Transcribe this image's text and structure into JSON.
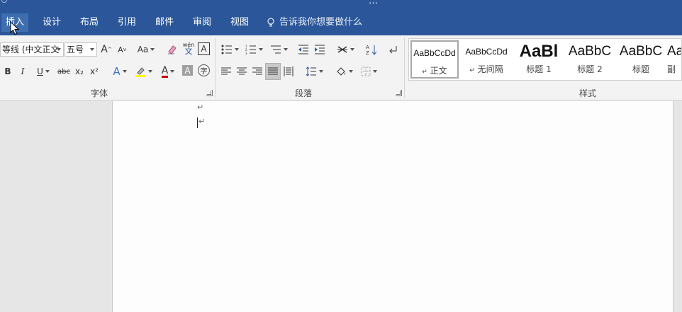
{
  "title_bar": {
    "title_fragment": "…"
  },
  "tabs": [
    {
      "label": "插入"
    },
    {
      "label": "设计"
    },
    {
      "label": "布局"
    },
    {
      "label": "引用"
    },
    {
      "label": "邮件"
    },
    {
      "label": "审阅"
    },
    {
      "label": "视图"
    }
  ],
  "tell_me": {
    "placeholder": "告诉我你想要做什么"
  },
  "font_group": {
    "label": "字体",
    "font_name": "等线 (中文正文",
    "font_size": "五号",
    "grow_font": "A",
    "shrink_font": "A",
    "change_case": "Aa",
    "phonetic_guide": "wén",
    "phonetic_char": "文",
    "char_border": "A",
    "bold": "B",
    "italic": "I",
    "underline": "U",
    "strikethrough": "abc",
    "subscript": "x₂",
    "superscript": "x²",
    "text_effects": "A",
    "font_color": "A",
    "char_shading": "A",
    "enclose_char": "字"
  },
  "paragraph_group": {
    "label": "段落"
  },
  "styles_group": {
    "label": "样式",
    "items": [
      {
        "sample": "AaBbCcDd",
        "name": "正文",
        "prefix": "↵",
        "selected": true
      },
      {
        "sample": "AaBbCcDd",
        "name": "无间隔",
        "prefix": "↵",
        "selected": false
      },
      {
        "sample": "AaBl",
        "name": "标题 1",
        "prefix": "",
        "selected": false
      },
      {
        "sample": "AaBbC",
        "name": "标题 2",
        "prefix": "",
        "selected": false
      },
      {
        "sample": "AaBbC",
        "name": "标题",
        "prefix": "",
        "selected": false
      },
      {
        "sample": "Aa",
        "name": "副",
        "prefix": "",
        "selected": false
      }
    ]
  },
  "document": {
    "paragraph_marks": [
      "↵",
      "↵"
    ]
  },
  "colors": {
    "tab_bar": "#2b579a",
    "active_tab": "#3e6db0",
    "ribbon": "#f3f3f3",
    "font_color_underline": "#c00000",
    "highlight": "#ffff00"
  }
}
